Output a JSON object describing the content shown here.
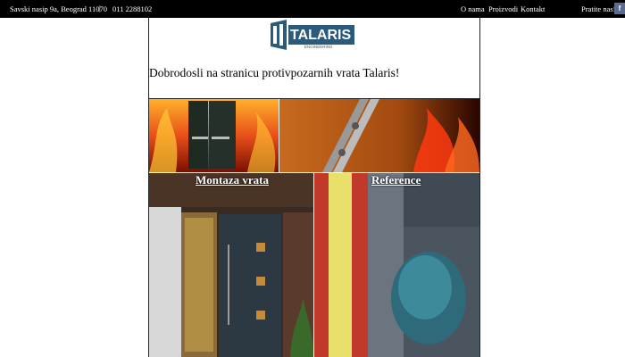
{
  "topbar": {
    "address": "Savski nasip 9a, Beograd 11070",
    "separator": "|",
    "phone": "011 2288102",
    "nav": [
      "O nama",
      "Proizvodi",
      "Kontakt"
    ],
    "follow": "Pratite nas!",
    "facebook_icon": "f"
  },
  "logo": {
    "name": "TALARIS",
    "sub": "ENGINEERING"
  },
  "welcome": "Dobrodosli na stranicu protivpozarnih vrata Talaris!",
  "tiles": {
    "montaza": "Montaza vrata",
    "reference": "Reference"
  },
  "colors": {
    "topbar": "#000000",
    "logo_blue": "#2b5a7a",
    "fire": "#e8501a"
  }
}
